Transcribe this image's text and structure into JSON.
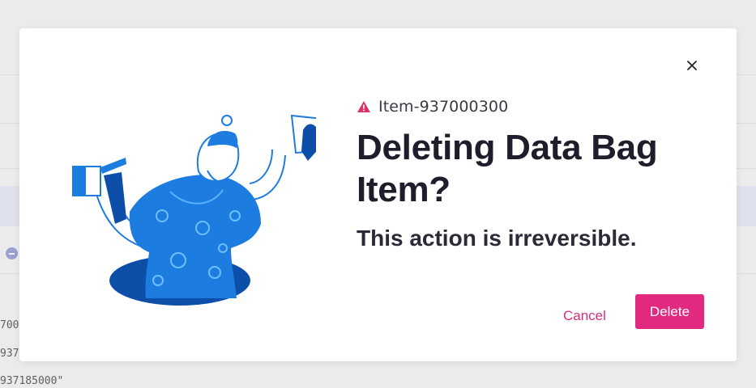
{
  "background": {
    "code_lines": [
      "700",
      "937",
      "937185000\""
    ]
  },
  "dialog": {
    "item_label": "Item-937000300",
    "title": "Deleting Data Bag Item?",
    "subtitle": "This action is irreversible.",
    "cancel_label": "Cancel",
    "delete_label": "Delete",
    "icons": [
      "warning-icon",
      "close-icon"
    ],
    "colors": {
      "accent": "#e0297f",
      "warning": "#d6336c",
      "illustration_blue": "#1c7ce0",
      "illustration_dark": "#0d4fa8"
    }
  }
}
